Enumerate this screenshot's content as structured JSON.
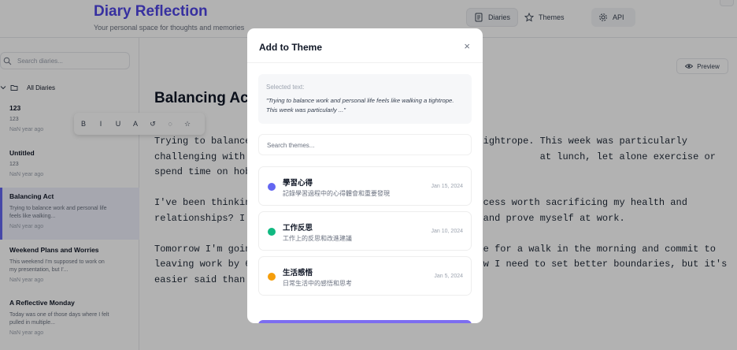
{
  "header": {
    "app_title": "Diary Reflection",
    "app_subtitle": "Your personal space for thoughts and memories",
    "nav": [
      {
        "label": "Diaries",
        "icon": "document-icon",
        "active": true
      },
      {
        "label": "Themes",
        "icon": "star-icon",
        "active": false
      },
      {
        "label": "API",
        "icon": "gear-icon",
        "active": false
      }
    ]
  },
  "sidebar": {
    "search_placeholder": "Search diaries...",
    "folder_label": "All Diaries",
    "items": [
      {
        "title": "123",
        "snippet": "123",
        "time": "NaN year ago",
        "selected": false
      },
      {
        "title": "Untitled",
        "snippet": "123",
        "time": "NaN year ago",
        "selected": false
      },
      {
        "title": "Balancing Act",
        "snippet": "Trying to balance work and personal life feels like walking...",
        "time": "NaN year ago",
        "selected": true
      },
      {
        "title": "Weekend Plans and Worries",
        "snippet": "This weekend I'm supposed to work on my presentation, but I'...",
        "time": "NaN year ago",
        "selected": false
      },
      {
        "title": "A Reflective Monday",
        "snippet": "Today was one of those days where I felt pulled in multiple...",
        "time": "NaN year ago",
        "selected": false
      }
    ]
  },
  "editor": {
    "preview_label": "Preview",
    "title": "Balancing Act",
    "toolbar": [
      "B",
      "I",
      "U",
      "A",
      "↺",
      "◌",
      "☆"
    ],
    "paragraphs": [
      "Trying to balance w                                       ightrope. This week was particularly challenging with back-to-back m                                     at lunch, let alone exercise or spend time on hobbies.",
      "I've been thinking                                       ccess worth sacrificing my health and relationships? I d                                   form and prove myself at work.",
      "Tomorrow I'm going                                       me for a walk in the morning and commit to leaving work by 6 P                                    know I need to set better boundaries, but it's easier said than do"
    ]
  },
  "modal": {
    "title": "Add to Theme",
    "close_label": "×",
    "selected_label": "Selected text:",
    "selected_quote": "\"Trying to balance work and personal life feels like walking a tightrope. This week was particularly ...\"",
    "search_placeholder": "Search themes...",
    "themes": [
      {
        "name": "學習心得",
        "description": "記錄學習過程中的心得體會和重要發現",
        "date": "Jan 15, 2024",
        "color": "#6366f1"
      },
      {
        "name": "工作反思",
        "description": "工作上的反思和改進建議",
        "date": "Jan 10, 2024",
        "color": "#10b981"
      },
      {
        "name": "生活感悟",
        "description": "日常生活中的感悟和思考",
        "date": "Jan 5, 2024",
        "color": "#f59e0b"
      }
    ]
  }
}
